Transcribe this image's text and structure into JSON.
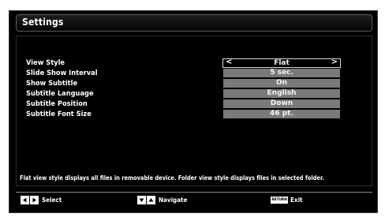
{
  "header": {
    "title": "Settings"
  },
  "settings": [
    {
      "label": "View Style",
      "value": "Flat",
      "selected": true
    },
    {
      "label": "Slide Show Interval",
      "value": "5 sec.",
      "selected": false
    },
    {
      "label": "Show Subtitle",
      "value": "On",
      "selected": false
    },
    {
      "label": "Subtitle Language",
      "value": "English",
      "selected": false
    },
    {
      "label": "Subtitle Position",
      "value": "Down",
      "selected": false
    },
    {
      "label": "Subtitle Font Size",
      "value": "46 pt.",
      "selected": false
    }
  ],
  "arrows": {
    "left": "<",
    "right": ">"
  },
  "help": {
    "text": "Flat view style displays all files in removable device. Folder view style displays files in selected folder."
  },
  "footer": {
    "select_label": "Select",
    "navigate_label": "Navigate",
    "return_key": "RETURN",
    "exit_label": "Exit"
  },
  "colors": {
    "background": "#000000",
    "value_box": "#7a7a7a",
    "text": "#ffffff"
  }
}
